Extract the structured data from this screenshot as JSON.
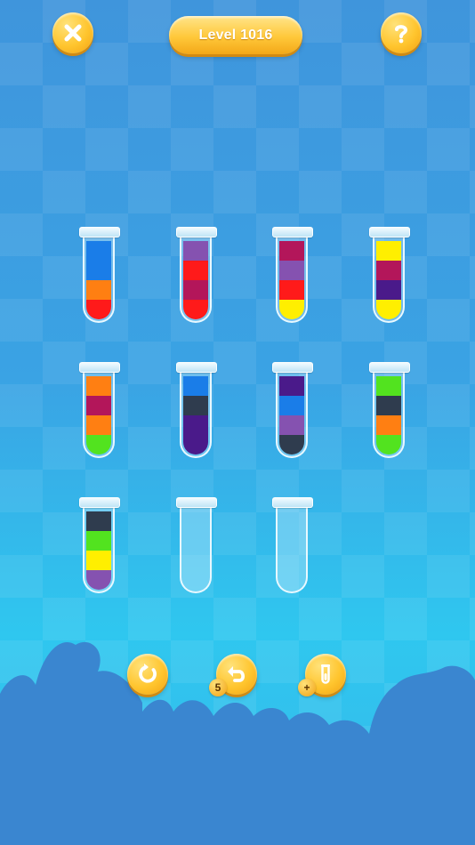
{
  "header": {
    "level_label": "Level 1016",
    "close_icon": "close-icon",
    "help_icon": "help-icon"
  },
  "colors": {
    "blue": "#1a7de8",
    "orange": "#ff7f12",
    "red": "#ff1a1a",
    "purple": "#8552b0",
    "crimson": "#b3165a",
    "yellow": "#ffef00",
    "indigo": "#4a1a8a",
    "dark": "#2f3c4e",
    "green": "#52e31f"
  },
  "tubes": [
    [
      "blue",
      "blue",
      "orange",
      "red"
    ],
    [
      "purple",
      "red",
      "crimson",
      "red"
    ],
    [
      "crimson",
      "purple",
      "red",
      "yellow"
    ],
    [
      "yellow",
      "crimson",
      "indigo",
      "yellow"
    ],
    [
      "orange",
      "crimson",
      "orange",
      "green"
    ],
    [
      "blue",
      "dark",
      "indigo",
      "indigo"
    ],
    [
      "indigo",
      "blue",
      "purple",
      "dark"
    ],
    [
      "green",
      "dark",
      "orange",
      "green"
    ],
    [
      "dark",
      "green",
      "yellow",
      "purple"
    ],
    [],
    []
  ],
  "toolbar": {
    "restart_icon": "restart-icon",
    "undo_icon": "undo-icon",
    "undo_count": "5",
    "add_tube_icon": "add-tube-icon",
    "add_badge": "+"
  }
}
